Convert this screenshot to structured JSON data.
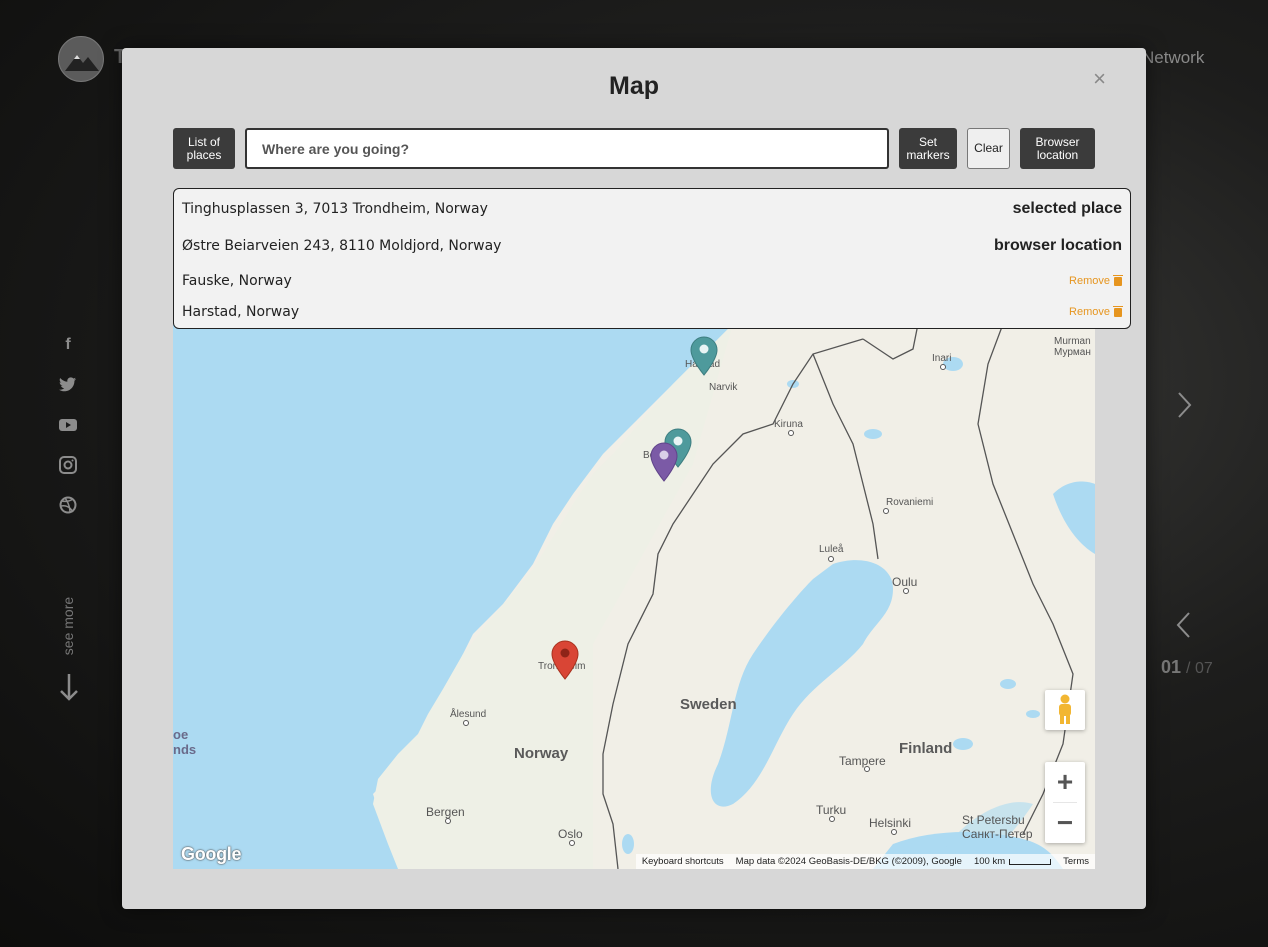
{
  "background": {
    "logo_letter": "T",
    "network_link": "Network",
    "social_icons": [
      "facebook-icon",
      "twitter-icon",
      "youtube-icon",
      "instagram-icon",
      "dribbble-icon"
    ],
    "see_more": "see more",
    "counter_current": "01",
    "counter_total": "/ 07"
  },
  "modal": {
    "title": "Map",
    "close_label": "×",
    "toolbar": {
      "list_of_places": "List of places",
      "search_placeholder": "Where are you going?",
      "set_markers": "Set markers",
      "clear": "Clear",
      "browser_location": "Browser location"
    },
    "places": [
      {
        "name": "Tinghusplassen 3, 7013 Trondheim, Norway",
        "tag": "selected place"
      },
      {
        "name": "Østre Beiarveien 243, 8110 Moldjord, Norway",
        "tag": "browser location"
      },
      {
        "name": "Fauske, Norway",
        "action": "Remove"
      },
      {
        "name": "Harstad, Norway",
        "action": "Remove"
      }
    ],
    "map": {
      "labels": {
        "harstad": "Harstad",
        "narvik": "Narvik",
        "kiruna": "Kiruna",
        "inari": "Inari",
        "murmansk": "Murman\nМурман",
        "bodo": "Bo",
        "rovaniemi": "Rovaniemi",
        "lulea": "Luleå",
        "oulu": "Oulu",
        "trondheim": "Trondheim",
        "alesund": "Ålesund",
        "faroe": "oe\nnds",
        "sweden": "Sweden",
        "norway": "Norway",
        "finland": "Finland",
        "tampere": "Tampere",
        "turku": "Turku",
        "helsinki": "Helsinki",
        "st_petersburg": "St Petersbu\nСанкт-Петер",
        "bergen": "Bergen",
        "oslo": "Oslo"
      },
      "google_logo": "Google",
      "attribution": {
        "keyboard": "Keyboard shortcuts",
        "mapdata": "Map data ©2024 GeoBasis-DE/BKG (©2009), Google",
        "scale": "100 km",
        "terms": "Terms"
      },
      "marker_colors": {
        "selected": "#d94535",
        "browser": "#7b5aa6",
        "place": "#4e9a9c"
      }
    }
  }
}
